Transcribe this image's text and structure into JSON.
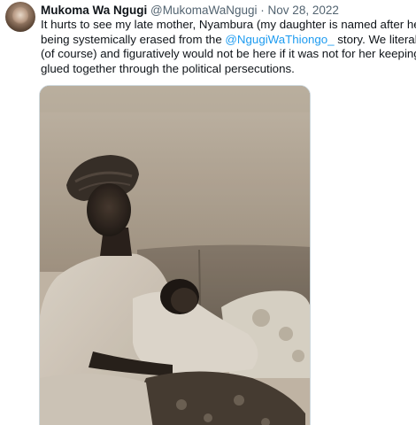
{
  "tweet": {
    "author": {
      "display_name": "Mukoma Wa Ngugi",
      "handle": "@MukomaWaNgugi",
      "separator": "·",
      "date": "Nov 28, 2022"
    },
    "text": {
      "line1": "It hurts to see my late mother, Nyambura (my daughter is named after her)",
      "line2_before": "being systemically erased from the ",
      "line2_mention": "@NgugiWaThiongo_",
      "line2_after": " story. We literally",
      "line3": "(of course) and figuratively would not be here if it was not for her keeping us",
      "line4": "glued together through the political persecutions."
    },
    "media": {
      "icon": "photo-icon"
    },
    "colors": {
      "link": "#1d9bf0",
      "secondary": "#536471",
      "text": "#0f1419"
    }
  }
}
